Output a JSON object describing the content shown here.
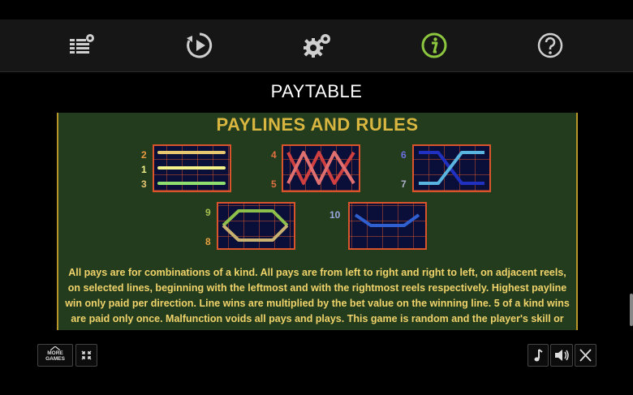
{
  "toolbar": {
    "icons": [
      "settings-list-icon",
      "autoplay-icon",
      "settings-icon",
      "info-icon",
      "help-icon"
    ],
    "active_color": "#8cc63f"
  },
  "page": {
    "title": "PAYTABLE"
  },
  "panel": {
    "title": "PAYLINES AND RULES",
    "colors": {
      "background": "#233c1e",
      "border": "#b9962a",
      "grid_border": "#d9542a",
      "grid_cell": "#0a0f3a"
    },
    "paylines": [
      {
        "numbers": [
          "2",
          "1",
          "3"
        ],
        "line_colors": [
          "#e8c770",
          "#f4f08a",
          "#90e070"
        ]
      },
      {
        "numbers": [
          "4",
          "5"
        ],
        "line_colors": [
          "#d04040",
          "#e07070"
        ]
      },
      {
        "numbers": [
          "6",
          "7"
        ],
        "line_colors": [
          "#2030c0",
          "#5ab4e0"
        ]
      },
      {
        "numbers": [
          "9",
          "8"
        ],
        "line_colors": [
          "#8cc04a",
          "#c8b070"
        ]
      },
      {
        "numbers": [
          "10"
        ],
        "line_colors": [
          "#3060d0"
        ]
      }
    ],
    "rules_text": "All pays are for combinations of a kind. All pays are from left to right and right to left, on adjacent reels, on selected lines, beginning with the leftmost and with the rightmost reels respectively. Highest payline win only paid per direction. Line wins are multiplied by the bet value on the winning line. 5 of a kind wins are paid only once. Malfunction voids all pays and plays. This game is random and the player's skill or"
  },
  "bottom_bar": {
    "more_games_line1": "MORE",
    "more_games_line2": "GAMES",
    "icons": [
      "collapse-icon",
      "music-icon",
      "sound-icon",
      "close-icon"
    ]
  }
}
